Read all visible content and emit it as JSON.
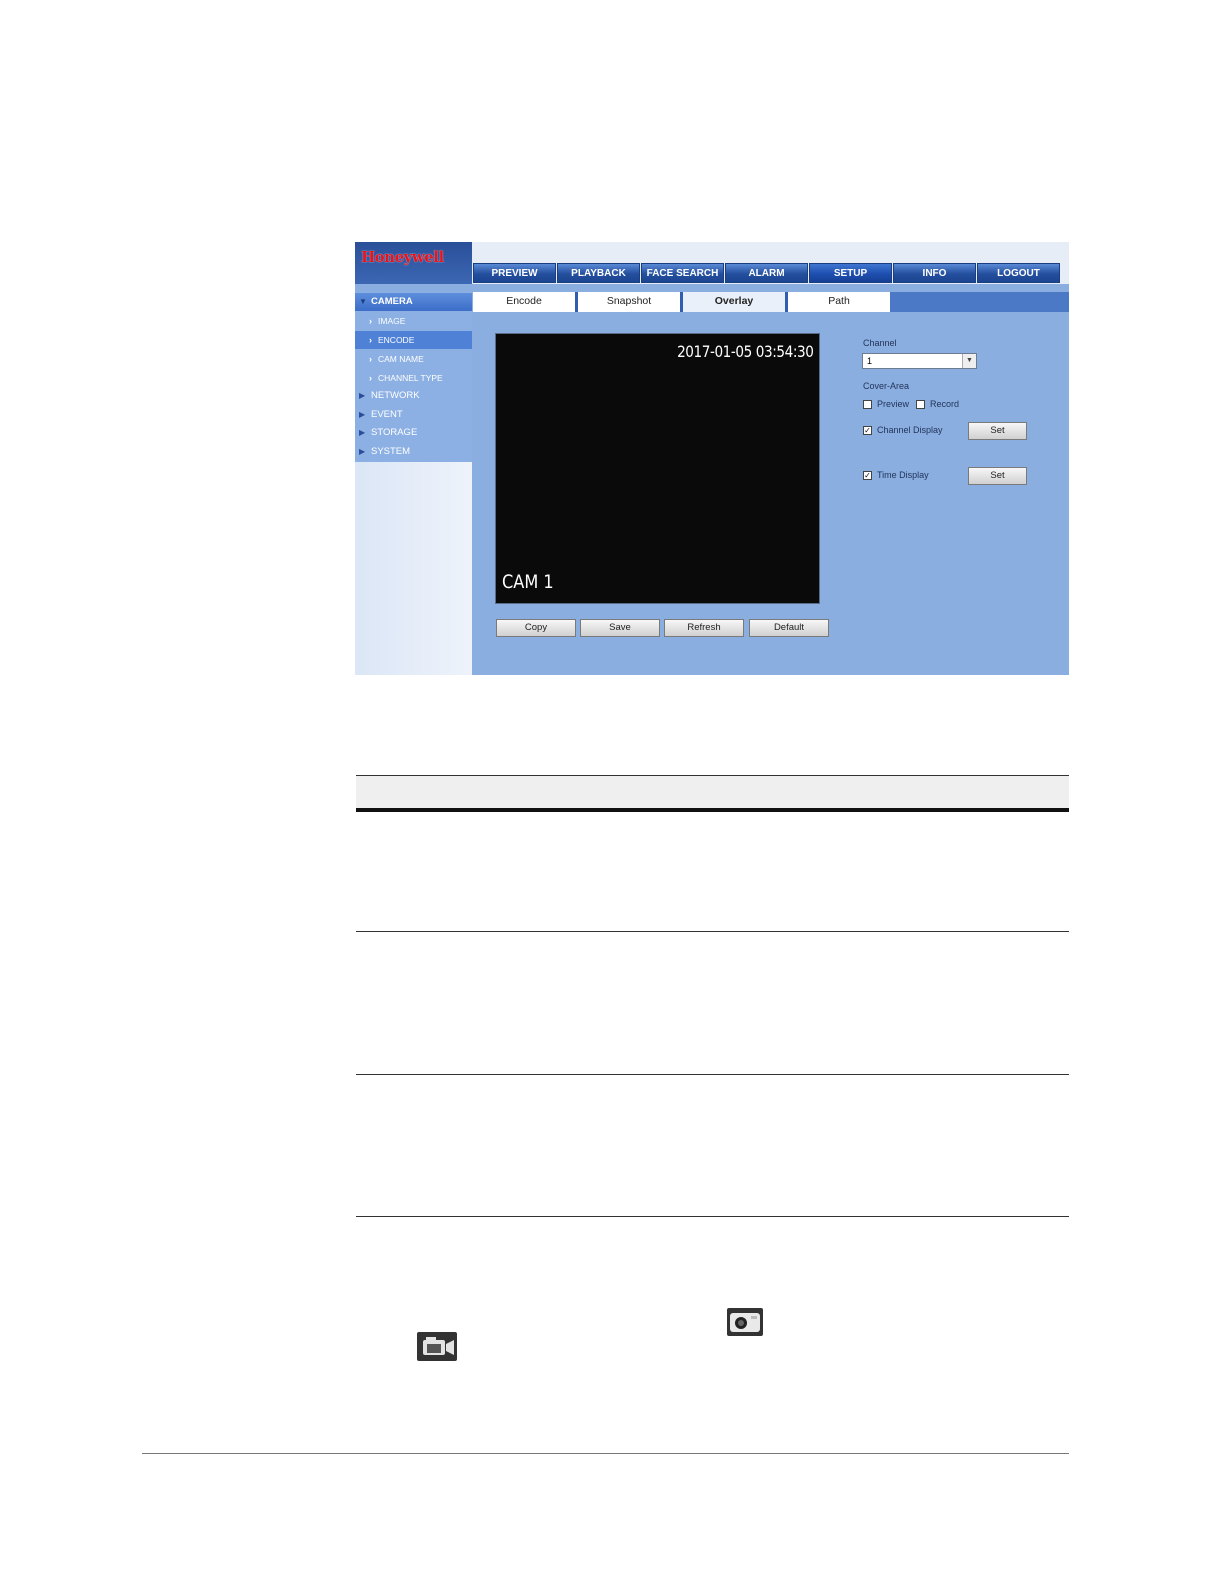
{
  "app": {
    "logo": "Honeywell"
  },
  "nav": [
    "PREVIEW",
    "PLAYBACK",
    "FACE SEARCH",
    "ALARM",
    "SETUP",
    "INFO",
    "LOGOUT"
  ],
  "nav_active": "SETUP",
  "sidebar": {
    "camera": "CAMERA",
    "sub": [
      "IMAGE",
      "ENCODE",
      "CAM NAME",
      "CHANNEL TYPE"
    ],
    "selected_sub": "ENCODE",
    "groups": [
      "NETWORK",
      "EVENT",
      "STORAGE",
      "SYSTEM"
    ]
  },
  "tabs": [
    "Encode",
    "Snapshot",
    "Overlay",
    "Path"
  ],
  "active_tab": "Overlay",
  "preview": {
    "timestamp": "2017-01-05 03:54:30",
    "camera_name": "CAM 1"
  },
  "buttons": [
    "Copy",
    "Save",
    "Refresh",
    "Default"
  ],
  "settings": {
    "channel_label": "Channel",
    "channel_value": "1",
    "cover_area_label": "Cover-Area",
    "preview_label": "Preview",
    "preview_checked": false,
    "record_label": "Record",
    "record_checked": false,
    "channel_display_label": "Channel Display",
    "channel_display_checked": true,
    "time_display_label": "Time Display",
    "time_display_checked": true,
    "set_label": "Set"
  },
  "icons": [
    "snapshot-icon",
    "video-camera-icon"
  ]
}
